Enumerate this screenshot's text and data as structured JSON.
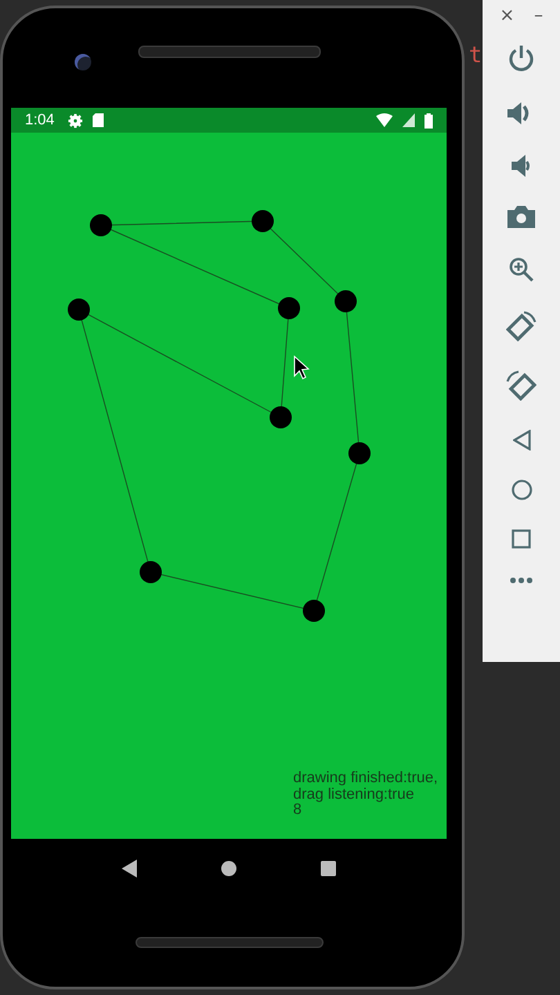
{
  "editor_fragment": "t",
  "emulator_toolbar": {
    "window_buttons": [
      "×",
      "–"
    ]
  },
  "status_bar": {
    "time": "1:04"
  },
  "app": {
    "status_lines": [
      "drawing finished:true,",
      "drag listening:true",
      "8"
    ]
  }
}
